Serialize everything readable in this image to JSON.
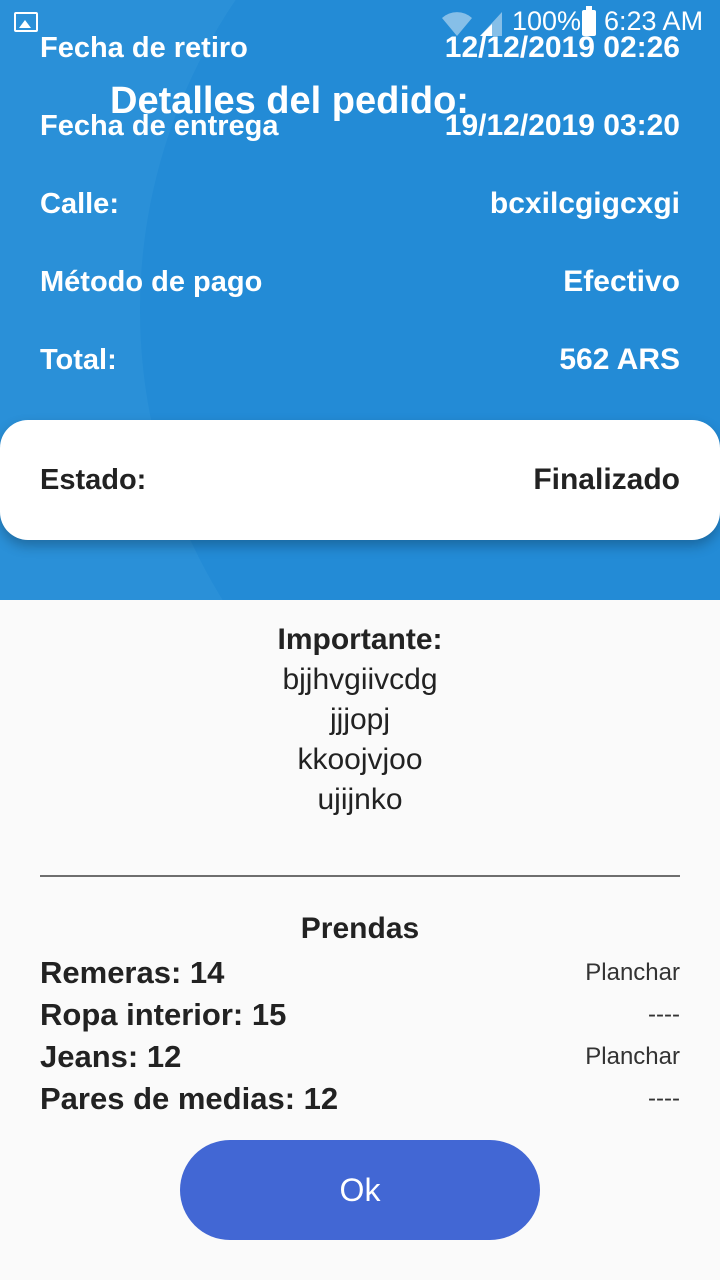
{
  "status_bar": {
    "battery_pct": "100%",
    "time": "6:23 AM"
  },
  "header": {
    "title": "Detalles del pedido:"
  },
  "details": [
    {
      "label": "Fecha de retiro",
      "value": "12/12/2019 02:26"
    },
    {
      "label": "Fecha de entrega",
      "value": "19/12/2019 03:20"
    },
    {
      "label": "Calle:",
      "value": "bcxilcgigcxgi"
    },
    {
      "label": "Método de pago",
      "value": "Efectivo"
    },
    {
      "label": "Total:",
      "value": "562 ARS"
    }
  ],
  "status": {
    "label": "Estado:",
    "value": "Finalizado"
  },
  "important": {
    "heading": "Importante:",
    "lines": [
      "bjjhvgiivcdg",
      "jjjopj",
      "kkoojvjoo",
      "ujijnko"
    ]
  },
  "garments": {
    "heading": "Prendas",
    "items": [
      {
        "name": "Remeras: 14",
        "service": "Planchar"
      },
      {
        "name": "Ropa interior: 15",
        "service": "----"
      },
      {
        "name": "Jeans: 12",
        "service": "Planchar"
      },
      {
        "name": "Pares de medias: 12",
        "service": "----"
      }
    ]
  },
  "ok_button": {
    "label": "Ok"
  },
  "colors": {
    "header_bg": "#2a90d8",
    "button_bg": "#4267d4"
  }
}
